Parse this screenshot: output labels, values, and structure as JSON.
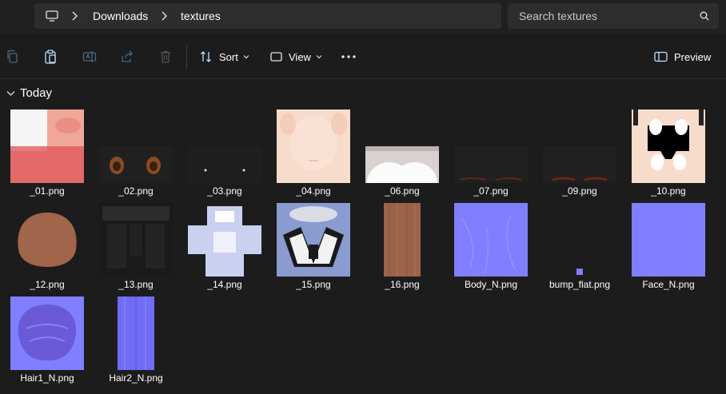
{
  "address": {
    "crumbs": [
      "Downloads",
      "textures"
    ]
  },
  "search": {
    "placeholder": "Search textures"
  },
  "toolbar": {
    "sort_label": "Sort",
    "view_label": "View",
    "preview_label": "Preview"
  },
  "group": {
    "label": "Today"
  },
  "files": [
    {
      "name": "_01.png",
      "thumb": "t01"
    },
    {
      "name": "_02.png",
      "thumb": "t02"
    },
    {
      "name": "_03.png",
      "thumb": "t03"
    },
    {
      "name": "_04.png",
      "thumb": "t04"
    },
    {
      "name": "_06.png",
      "thumb": "t06"
    },
    {
      "name": "_07.png",
      "thumb": "t07"
    },
    {
      "name": "_09.png",
      "thumb": "t09"
    },
    {
      "name": "_10.png",
      "thumb": "t10"
    },
    {
      "name": "_12.png",
      "thumb": "t12"
    },
    {
      "name": "_13.png",
      "thumb": "t13"
    },
    {
      "name": "_14.png",
      "thumb": "t14"
    },
    {
      "name": "_15.png",
      "thumb": "t15"
    },
    {
      "name": "_16.png",
      "thumb": "t16"
    },
    {
      "name": "Body_N.png",
      "thumb": "tbody"
    },
    {
      "name": "bump_flat.png",
      "thumb": "tbump"
    },
    {
      "name": "Face_N.png",
      "thumb": "tface"
    },
    {
      "name": "Hair1_N.png",
      "thumb": "thair1"
    },
    {
      "name": "Hair2_N.png",
      "thumb": "thair2"
    }
  ],
  "colors": {
    "normal_map": "#7f7fff",
    "skin": "#f7dccb",
    "accent_red": "#e46a6a"
  }
}
